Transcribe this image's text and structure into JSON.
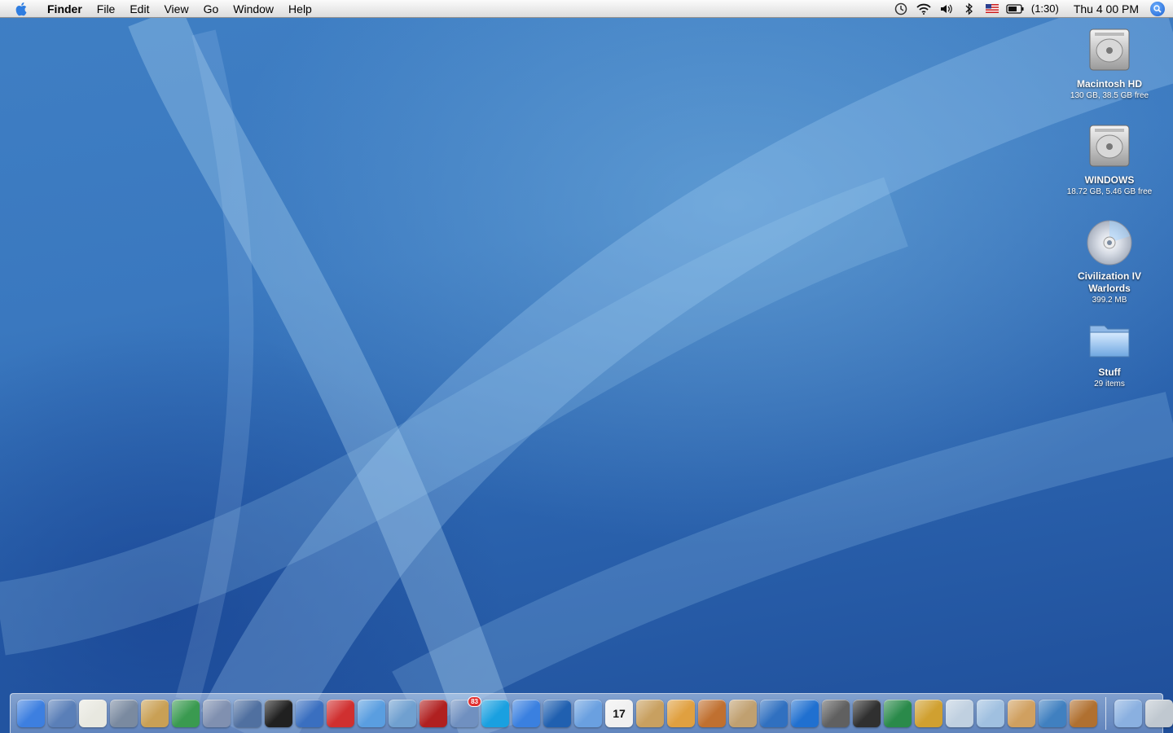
{
  "menubar": {
    "app_name": "Finder",
    "menus": [
      "File",
      "Edit",
      "View",
      "Go",
      "Window",
      "Help"
    ],
    "battery_time": "(1:30)",
    "clock": "Thu 4 00 PM",
    "status_icons": [
      "timemachine-icon",
      "wifi-icon",
      "volume-icon",
      "bluetooth-icon",
      "us-flag-input-icon",
      "battery-icon",
      "spotlight-icon"
    ]
  },
  "desktop": {
    "items": [
      {
        "name": "Macintosh HD",
        "info": "130 GB, 38.5 GB free",
        "icon": "hard-drive-icon"
      },
      {
        "name": "WINDOWS",
        "info": "18.72 GB, 5.46 GB free",
        "icon": "hard-drive-icon"
      },
      {
        "name": "Civilization IV Warlords",
        "info": "399.2 MB",
        "icon": "cd-disc-icon"
      },
      {
        "name": "Stuff",
        "info": "29 items",
        "icon": "folder-icon"
      }
    ]
  },
  "dock": {
    "apps": [
      {
        "icon": "finder-icon",
        "color": "#3d7fe0"
      },
      {
        "icon": "xcode-icon",
        "color": "#5a7fb8"
      },
      {
        "icon": "textedit-icon",
        "color": "#e8e8e0"
      },
      {
        "icon": "script-editor-icon",
        "color": "#7a8aa0"
      },
      {
        "icon": "keynote-icon",
        "color": "#c9a055"
      },
      {
        "icon": "grapher-icon",
        "color": "#3a9a50"
      },
      {
        "icon": "vmware-icon",
        "color": "#8090b0"
      },
      {
        "icon": "preview-icon",
        "color": "#5070a0"
      },
      {
        "icon": "terminal-icon",
        "color": "#202020"
      },
      {
        "icon": "pages-icon",
        "color": "#3a6fc0"
      },
      {
        "icon": "toolbox-icon",
        "color": "#d03030"
      },
      {
        "icon": "safari-icon",
        "color": "#5a9ee0"
      },
      {
        "icon": "photo-browser-icon",
        "color": "#70a0d0"
      },
      {
        "icon": "flashcard-icon",
        "color": "#b02020"
      },
      {
        "icon": "mail-icon",
        "color": "#7090c0"
      },
      {
        "icon": "skype-icon",
        "color": "#1aa0e0"
      },
      {
        "icon": "ichat-icon",
        "color": "#3a80e0"
      },
      {
        "icon": "google-earth-icon",
        "color": "#2060b0"
      },
      {
        "icon": "itunes-icon",
        "color": "#6aa0e0"
      },
      {
        "icon": "ical-icon",
        "color": "#f0f0f0"
      },
      {
        "icon": "address-book-icon",
        "color": "#c8a060"
      },
      {
        "icon": "iphoto-icon",
        "color": "#e0a040"
      },
      {
        "icon": "garageband-icon",
        "color": "#c07030"
      },
      {
        "icon": "dashboard-icon",
        "color": "#c0a070"
      },
      {
        "icon": "iweb-icon",
        "color": "#3070c0"
      },
      {
        "icon": "dvd-player-icon",
        "color": "#2070d0"
      },
      {
        "icon": "photo-booth-icon",
        "color": "#606060"
      },
      {
        "icon": "imovie-icon",
        "color": "#303030"
      },
      {
        "icon": "soundtrack-icon",
        "color": "#2a8a4a"
      },
      {
        "icon": "aperture-icon",
        "color": "#d0a030"
      },
      {
        "icon": "photo-frame-icon",
        "color": "#c0d0e0"
      },
      {
        "icon": "magnifier-icon",
        "color": "#a0c0e0"
      },
      {
        "icon": "chess-icon",
        "color": "#d0a060"
      },
      {
        "icon": "mixer-icon",
        "color": "#4080c0"
      },
      {
        "icon": "stuffit-icon",
        "color": "#b07030"
      }
    ],
    "right": [
      {
        "icon": "documents-folder-icon",
        "color": "#8ab0e0"
      },
      {
        "icon": "trash-icon",
        "color": "#c0c8d0"
      }
    ],
    "ical_day": "17",
    "mail_badge": "83"
  }
}
